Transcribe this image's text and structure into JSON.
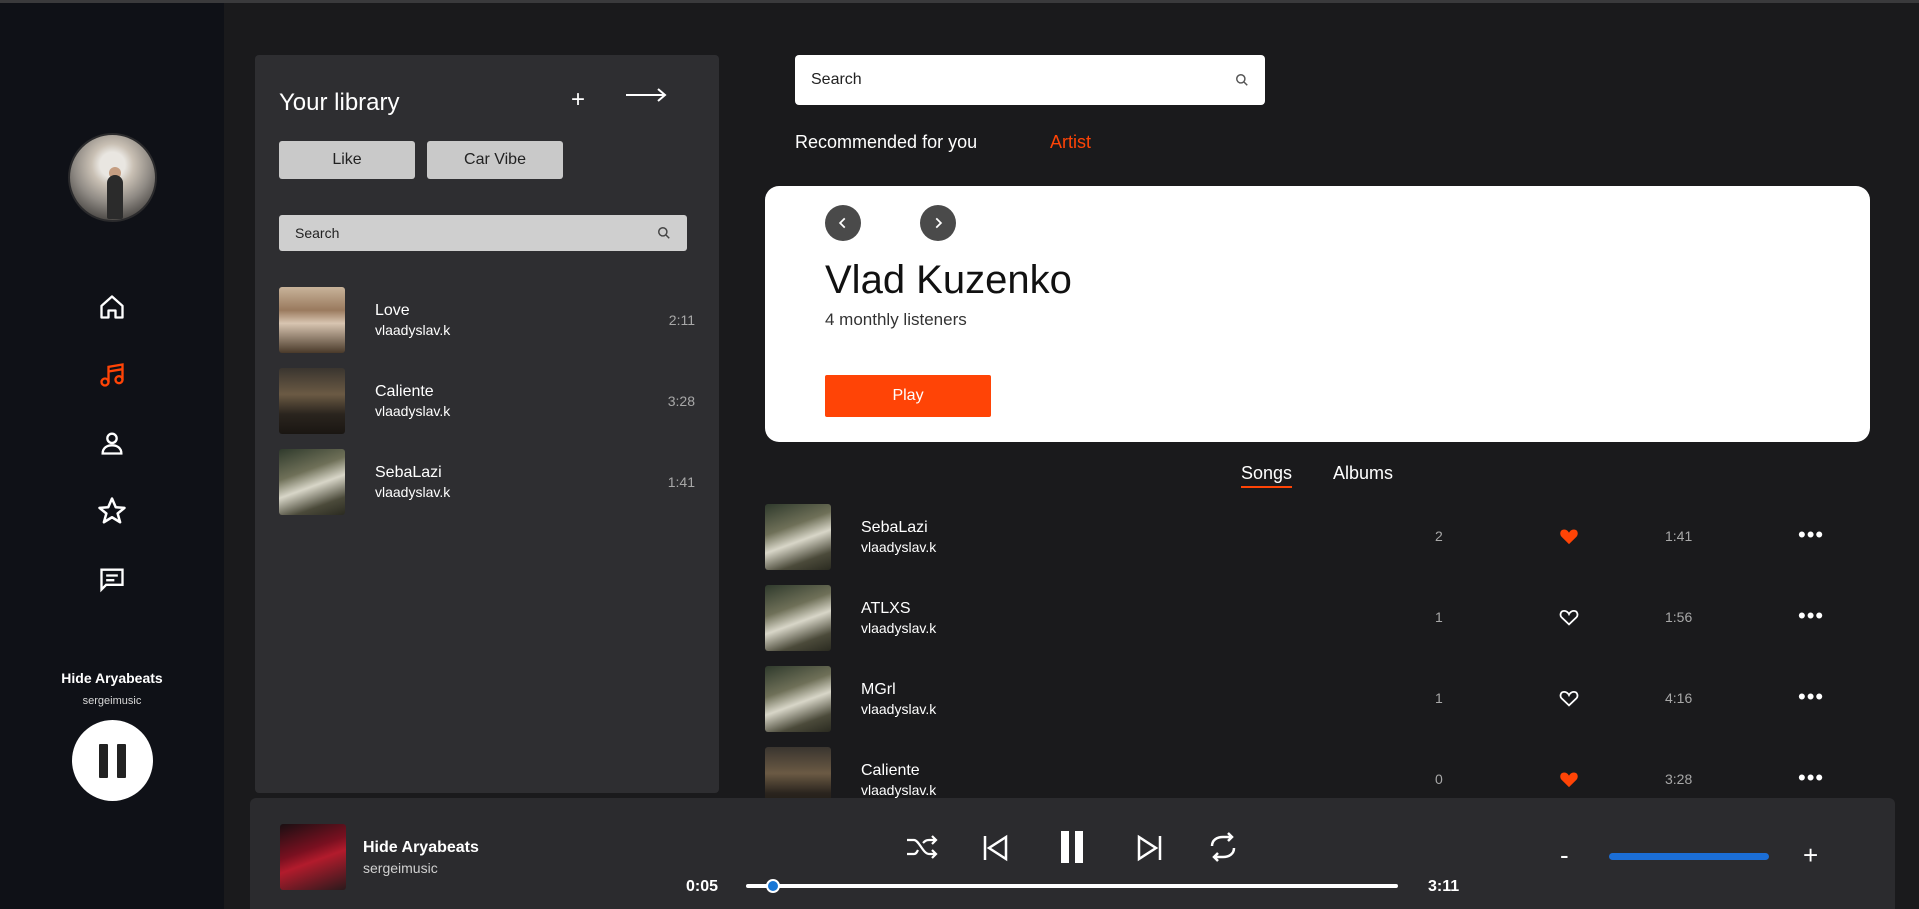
{
  "nav": {
    "items": [
      "home-icon",
      "music-note-icon",
      "user-icon",
      "star-icon",
      "message-icon"
    ],
    "active": "music-note-icon",
    "accent": "#ff4406",
    "now_playing": {
      "title": "Hide Aryabeats",
      "artist": "sergeimusic"
    }
  },
  "library": {
    "title": "Your library",
    "add_label": "+",
    "filters": [
      "Like",
      "Car Vibe"
    ],
    "search_placeholder": "Search",
    "tracks": [
      {
        "name": "Love",
        "artist": "vlaadyslav.k",
        "duration": "2:11"
      },
      {
        "name": "Caliente",
        "artist": "vlaadyslav.k",
        "duration": "3:28"
      },
      {
        "name": "SebaLazi",
        "artist": "vlaadyslav.k",
        "duration": "1:41"
      }
    ]
  },
  "main": {
    "search_placeholder": "Search",
    "tabs": [
      "Recommended for you",
      "Artist"
    ],
    "active_tab": "Artist",
    "hero": {
      "name": "Vlad Kuzenko",
      "listeners": "4 monthly listeners",
      "play_label": "Play"
    },
    "content_tabs": [
      "Songs",
      "Albums"
    ],
    "songs": [
      {
        "name": "SebaLazi",
        "artist": "vlaadyslav.k",
        "plays": "2",
        "liked": true,
        "duration": "1:41",
        "more": "•••"
      },
      {
        "name": "ATLXS",
        "artist": "vlaadyslav.k",
        "plays": "1",
        "liked": false,
        "duration": "1:56",
        "more": "•••"
      },
      {
        "name": "MGrl",
        "artist": "vlaadyslav.k",
        "plays": "1",
        "liked": false,
        "duration": "4:16",
        "more": "•••"
      },
      {
        "name": "Caliente",
        "artist": "vlaadyslav.k",
        "plays": "0",
        "liked": true,
        "duration": "3:28",
        "more": "•••"
      }
    ]
  },
  "player": {
    "title": "Hide Aryabeats",
    "artist": "sergeimusic",
    "elapsed": "0:05",
    "total": "3:11",
    "progress": 0.03,
    "volume": 1.0,
    "volume_down": "-",
    "volume_up": "+",
    "progress_color": "#1877d6"
  }
}
